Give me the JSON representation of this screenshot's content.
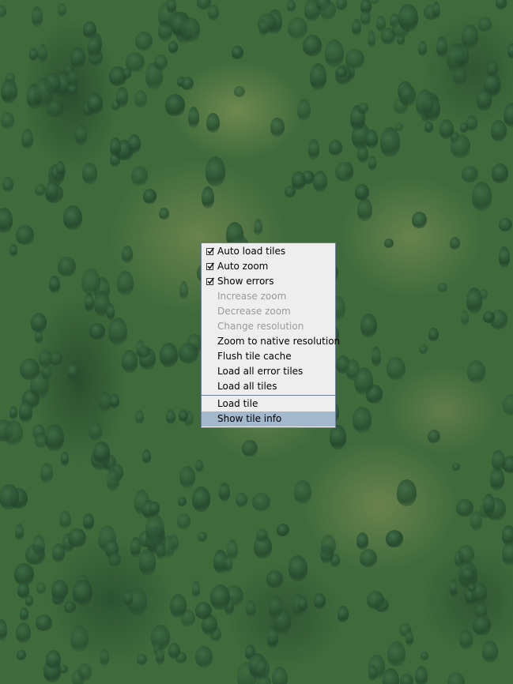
{
  "menu": {
    "items": [
      {
        "label": "Auto load tiles",
        "checked": true,
        "enabled": true
      },
      {
        "label": "Auto zoom",
        "checked": true,
        "enabled": true
      },
      {
        "label": "Show errors",
        "checked": true,
        "enabled": true
      },
      {
        "label": "Increase zoom",
        "enabled": false
      },
      {
        "label": "Decrease zoom",
        "enabled": false
      },
      {
        "label": "Change resolution",
        "enabled": false
      },
      {
        "label": "Zoom to native resolution",
        "enabled": true
      },
      {
        "label": "Flush tile cache",
        "enabled": true
      },
      {
        "label": "Load all error tiles",
        "enabled": true
      },
      {
        "label": "Load all tiles",
        "enabled": true
      },
      {
        "label": "Load tile",
        "enabled": true
      },
      {
        "label": "Show tile info",
        "enabled": true,
        "selected": true
      }
    ]
  },
  "colors": {
    "menu_background": "#eeeeee",
    "menu_border": "#6f7f99",
    "selected_background": "#a3b8cc",
    "disabled_text": "#9a9a9a",
    "imagery_base": "#3f6b3c"
  }
}
